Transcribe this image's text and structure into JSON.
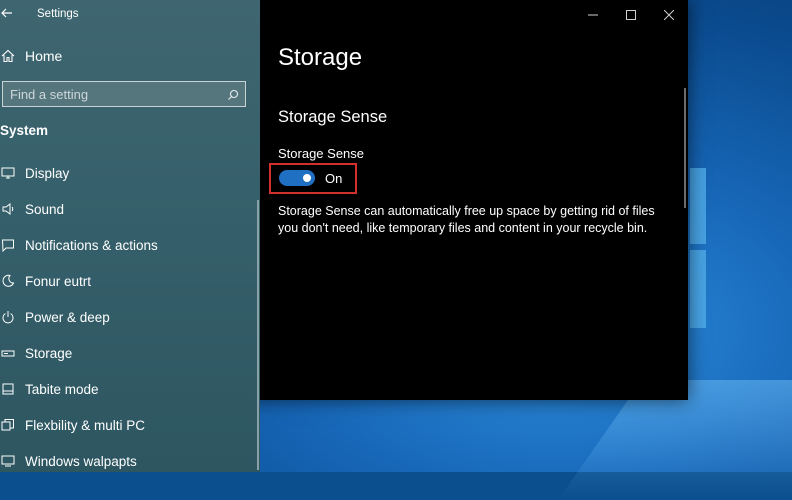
{
  "window": {
    "title": "Settings",
    "controls": {
      "minimize": "minimize",
      "maximize": "maximize",
      "close": "close"
    }
  },
  "sidebar": {
    "home_label": "Home",
    "search": {
      "placeholder": "Find a setting"
    },
    "section_label": "System",
    "items": [
      {
        "label": "Display",
        "icon": "display-icon"
      },
      {
        "label": "Sound",
        "icon": "sound-icon"
      },
      {
        "label": "Notifications & actions",
        "icon": "notifications-icon"
      },
      {
        "label": "Fonur eutrt",
        "icon": "focus-assist-icon"
      },
      {
        "label": "Power & deep",
        "icon": "power-icon"
      },
      {
        "label": "Storage",
        "icon": "storage-icon"
      },
      {
        "label": "Tabite mode",
        "icon": "tablet-mode-icon"
      },
      {
        "label": "Flexbility & multi PC",
        "icon": "multitasking-icon"
      },
      {
        "label": "Windows walpapts",
        "icon": "projecting-icon"
      }
    ]
  },
  "content": {
    "page_title": "Storage",
    "group_title": "Storage Sense",
    "toggle": {
      "label": "Storage Sense",
      "state": "On",
      "is_on": true
    },
    "description": "Storage Sense can automatically free up space by getting rid of files you don't need, like temporary files and content in your recycle bin."
  },
  "colors": {
    "accent": "#1f6fc2",
    "highlight_border": "#d0312d",
    "sidebar_bg": "#3a626c",
    "content_bg": "#000000"
  }
}
